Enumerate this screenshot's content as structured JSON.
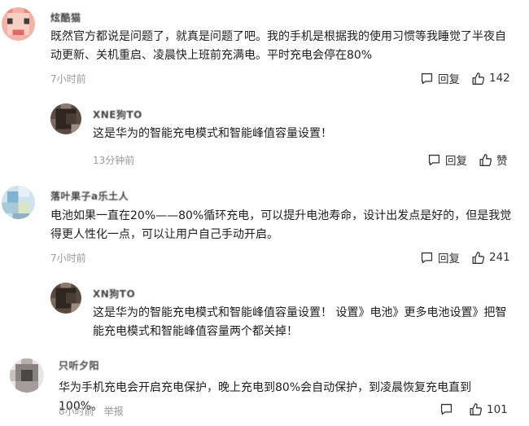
{
  "comments": [
    {
      "username": "炫酷猫",
      "text": "既然官方都说是问题了，就真是问题了吧。我的手机是根据我的使用习惯等我睡觉了半夜自动更新、关机重启、凌晨快上班前充满电。平时充电会停在80%",
      "time": "7小时前",
      "reply_label": "回复",
      "like_count": "142"
    },
    {
      "username": "XNE狗TO",
      "text": "这是华为的智能充电模式和智能峰值容量设置！",
      "time": "13分钟前",
      "reply_label": "回复",
      "like_label": "赞"
    },
    {
      "username": "落叶果子a乐土人",
      "text": "电池如果一直在20%——80%循环充电，可以提升电池寿命，设计出发点是好的，但是我觉得更人性化一点，可以让用户自己手动开启。",
      "time": "7小时前",
      "reply_label": "回复",
      "like_count": "241"
    },
    {
      "username": "XN狗TO",
      "text": "这是华为的智能充电模式和智能峰值容量设置！ 设置》电池》更多电池设置》把智能充电模式和智能峰值容量两个都关掉！",
      "time": "",
      "reply_label": "",
      "like_label": ""
    },
    {
      "username": "只听夕阳",
      "text": "华为手机充电会开启充电保护，晚上充电到80%会自动保护，到凌晨恢复充电直到100%。",
      "time": "8小时前",
      "report_label": "举报",
      "like_count": "101"
    }
  ],
  "colors": {
    "text": "#1e1e1e",
    "meta": "#999999",
    "action": "#333333"
  },
  "icons": {
    "reply": "comment-bubble-icon",
    "like": "thumbs-up-icon"
  }
}
